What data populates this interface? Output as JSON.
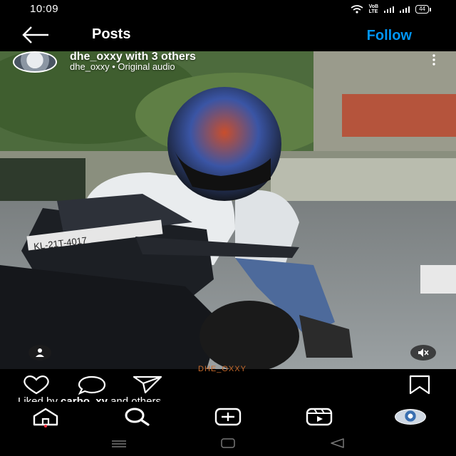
{
  "status": {
    "time": "10:09",
    "volte_top": "VoB",
    "volte_bottom": "LTE",
    "battery": "44"
  },
  "header": {
    "title": "Posts",
    "follow_label": "Follow"
  },
  "post": {
    "username_line": "dhe_oxxy with 3 others",
    "audio_line": "dhe_oxxy • Original audio",
    "plate_text": "KL-21T-4017",
    "watermark": "DHE_OXXY",
    "liked_by_prefix": "Liked by ",
    "liked_by_user": "carbo_xy",
    "liked_by_suffix": " and others"
  },
  "icons": {
    "back": "arrow-left-icon",
    "more": "more-vertical-icon",
    "tag": "user-tag-icon",
    "mute": "speaker-muted-icon",
    "like": "heart-icon",
    "comment": "comment-icon",
    "share": "send-icon",
    "save": "bookmark-icon",
    "home": "home-icon",
    "search": "search-icon",
    "create": "plus-square-icon",
    "reels": "reels-icon"
  },
  "colors": {
    "accent": "#0095f6",
    "notification_dot": "#ff3040",
    "background": "#000000"
  }
}
